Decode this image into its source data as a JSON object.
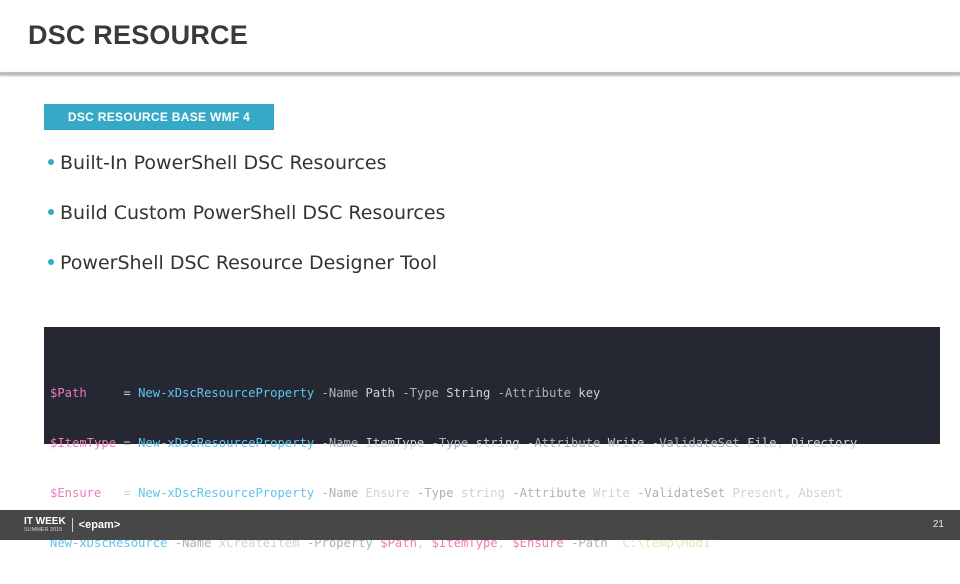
{
  "header": {
    "title": "DSC RESOURCE"
  },
  "tag": {
    "label": "DSC RESOURCE BASE WMF 4"
  },
  "bullets": [
    "Built-In PowerShell DSC Resources",
    "Build Custom PowerShell DSC Resources",
    "PowerShell DSC Resource Designer Tool"
  ],
  "code": {
    "lines": [
      "$Path     = New-xDscResourceProperty -Name Path -Type String -Attribute key",
      "$ItemType = New-xDscResourceProperty -Name ItemType -Type string -Attribute Write -ValidateSet File, Directory",
      "$Ensure   = New-xDscResourceProperty -Name Ensure -Type string -Attribute Write -ValidateSet Present, Absent",
      "New-xDscResource -Name xCreateItem -Property $Path, $ItemType, $Ensure -Path 'C:\\temp\\Mod1'"
    ]
  },
  "footer": {
    "logo_line1": "IT WEEK",
    "logo_line2": "SUMMER 2015",
    "logo_brand": "<epam>",
    "page_number": "21"
  },
  "colors": {
    "accent": "#36a9c6",
    "code_background": "#252833",
    "footer_background": "#474747",
    "title": "#3a3a3a"
  }
}
